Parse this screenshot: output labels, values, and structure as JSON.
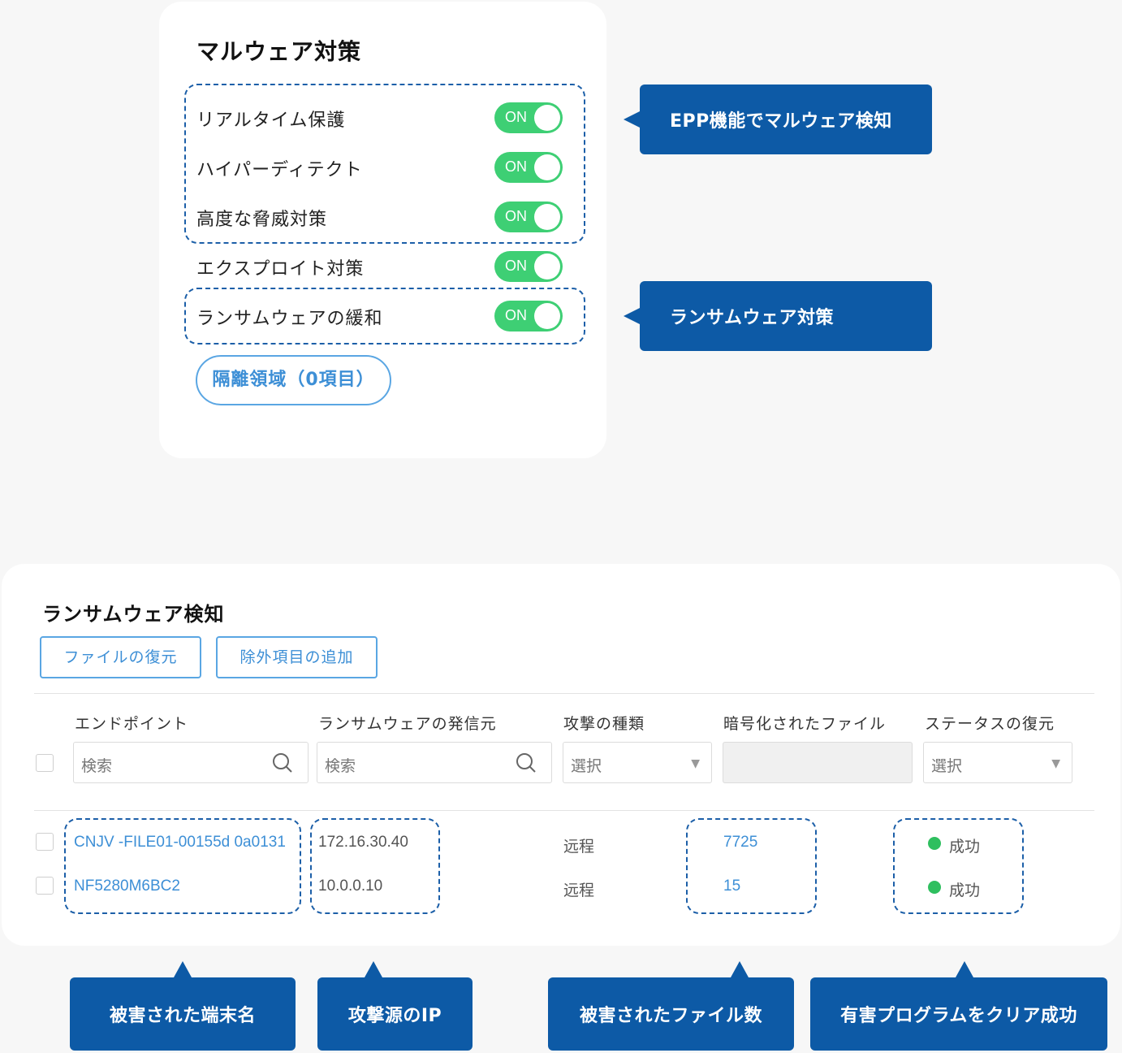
{
  "malware": {
    "title": "マルウェア対策",
    "toggle_label": "ON",
    "rows": [
      {
        "label": "リアルタイム保護"
      },
      {
        "label": "ハイパーディテクト"
      },
      {
        "label": "高度な脅威対策"
      },
      {
        "label": "エクスプロイト対策"
      },
      {
        "label": "ランサムウェアの緩和"
      }
    ],
    "quarantine_button": "隔離領域（0項目）"
  },
  "callouts": {
    "epp": "EPP機能でマルウェア検知",
    "ransom": "ランサムウェア対策",
    "device": "被害された端末名",
    "ip": "攻撃源のIP",
    "files": "被害されたファイル数",
    "cleared": "有害プログラムをクリア成功"
  },
  "ransomware": {
    "title": "ランサムウェア検知",
    "buttons": {
      "restore": "ファイルの復元",
      "add_exclusion": "除外項目の追加"
    },
    "columns": [
      "エンドポイント",
      "ランサムウェアの発信元",
      "攻撃の種類",
      "暗号化されたファイル",
      "ステータスの復元"
    ],
    "filters": {
      "search_placeholder": "検索",
      "select_placeholder": "選択"
    },
    "rows": [
      {
        "endpoint": "CNJV -FILE01-00155d 0a0131",
        "source": "172.16.30.40",
        "attack_type": "远程",
        "encrypted_files": "7725",
        "status": "成功"
      },
      {
        "endpoint": "NF5280M6BC2",
        "source": "10.0.0.10",
        "attack_type": "远程",
        "encrypted_files": "15",
        "status": "成功"
      }
    ]
  },
  "colors": {
    "accent": "#0d5aa6",
    "toggle_on": "#3ecf74",
    "link": "#3d8fd6",
    "success": "#2fbf5f"
  }
}
